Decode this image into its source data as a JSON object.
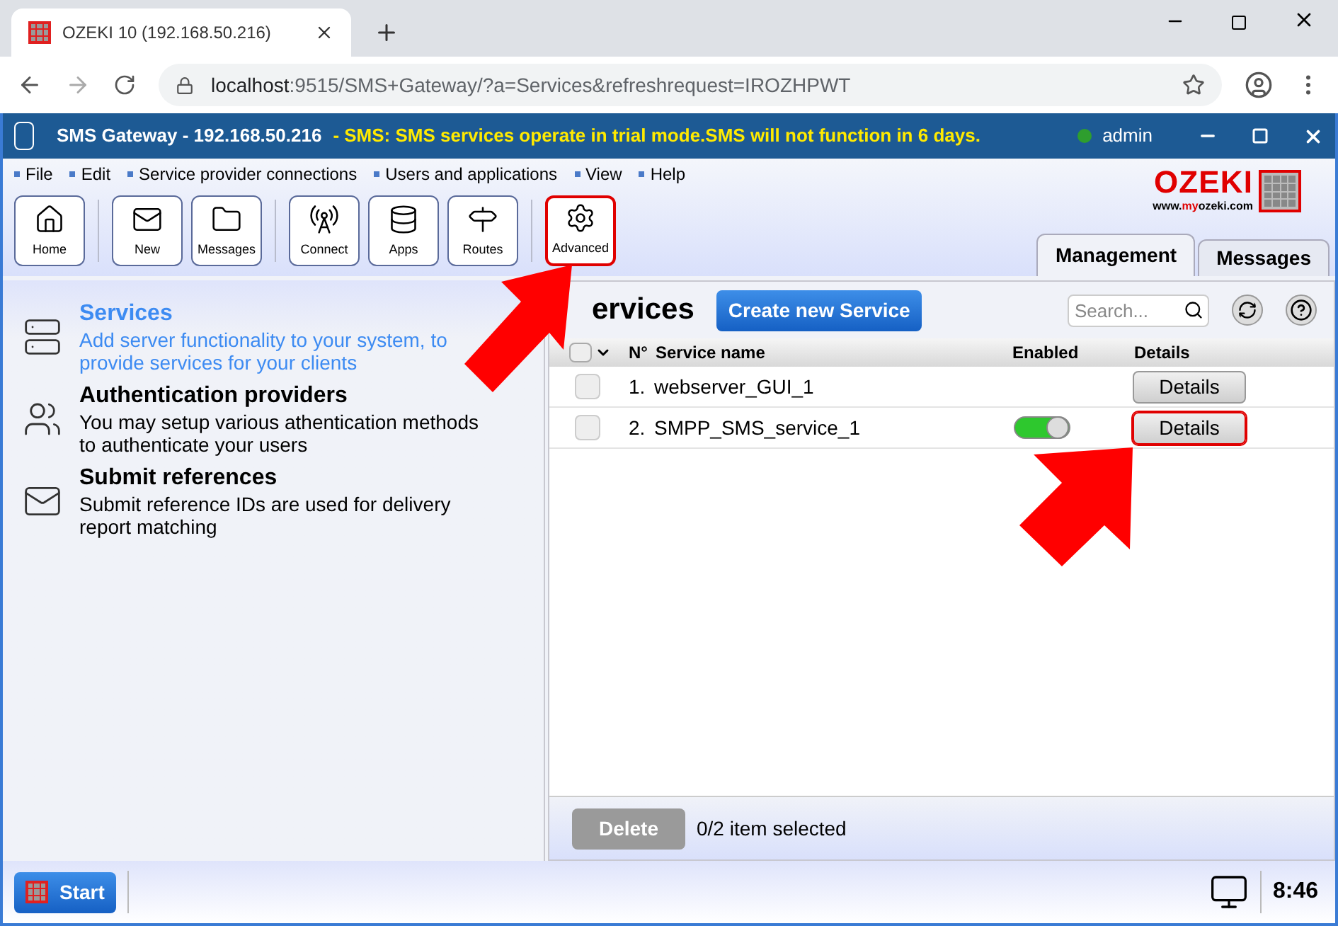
{
  "browser": {
    "tab_title": "OZEKI 10 (192.168.50.216)",
    "url_host": "localhost",
    "url_rest": ":9515/SMS+Gateway/?a=Services&refreshrequest=IROZHPWT"
  },
  "app_bar": {
    "title": "SMS Gateway - 192.168.50.216",
    "notice": "- SMS: SMS services operate in trial mode.SMS will not function in 6 days.",
    "user": "admin"
  },
  "menu": [
    "File",
    "Edit",
    "Service provider connections",
    "Users and applications",
    "View",
    "Help"
  ],
  "toolbar_groups": [
    [
      {
        "kind": "home",
        "label": "Home",
        "highlighted": false
      }
    ],
    [
      {
        "kind": "new",
        "label": "New",
        "highlighted": false
      },
      {
        "kind": "messages",
        "label": "Messages",
        "highlighted": false
      }
    ],
    [
      {
        "kind": "connect",
        "label": "Connect",
        "highlighted": false
      },
      {
        "kind": "apps",
        "label": "Apps",
        "highlighted": false
      },
      {
        "kind": "routes",
        "label": "Routes",
        "highlighted": false
      }
    ],
    [
      {
        "kind": "advanced",
        "label": "Advanced",
        "highlighted": true
      }
    ]
  ],
  "logo": {
    "name": "OZEKI",
    "site_pre": "www.",
    "site_mid": "my",
    "site_post": "ozeki.com"
  },
  "view_tabs": [
    {
      "label": "Management",
      "selected": true
    },
    {
      "label": "Messages",
      "selected": false
    }
  ],
  "sidebar": [
    {
      "kind": "server",
      "title": "Services",
      "text": "Add server functionality to your system, to provide services for your clients",
      "selected": true
    },
    {
      "kind": "users",
      "title": "Authentication providers",
      "text": "You may setup various athentication methods to authenticate your users",
      "selected": false
    },
    {
      "kind": "envelope",
      "title": "Submit references",
      "text": "Submit reference IDs are used for delivery report matching",
      "selected": false
    }
  ],
  "panel": {
    "heading": "ervices",
    "create_button": "Create new Service",
    "search": {
      "placeholder": "Search..."
    },
    "all_checked": false,
    "columns": [
      "N°",
      "Service name",
      "Enabled",
      "Details"
    ],
    "rows": [
      {
        "number": "1.",
        "name": "webserver_GUI_1",
        "checked": false,
        "details": "Details",
        "highlighted": false
      },
      {
        "number": "2.",
        "name": "SMPP_SMS_service_1",
        "checked": false,
        "enabled": true,
        "details": "Details",
        "highlighted": true
      }
    ],
    "delete_button": "Delete",
    "selection_count": "0/2 item selected"
  },
  "taskbar": {
    "start": "Start",
    "time": "8:46"
  }
}
